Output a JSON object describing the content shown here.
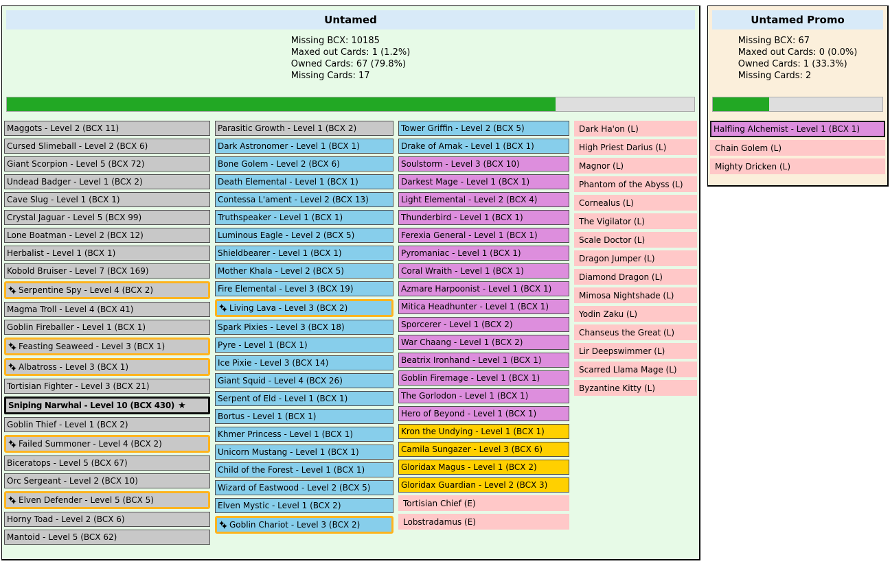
{
  "colors": {
    "panel_untamed_bg": "#E7FAE7",
    "panel_promo_bg": "#FBEFDB",
    "header_bg": "#D8EAF8",
    "progress_fill": "#22A824",
    "common": "#C8C8C8",
    "rare": "#87CEEB",
    "epic": "#DD8EDD",
    "legendary": "#FFD000",
    "missing": "#FFC8C8",
    "foil_border": "#FFB41E"
  },
  "icons": {
    "gold_foil_icon": "sparkles",
    "max_level_icon": "★"
  },
  "panels": [
    {
      "title": "Untamed",
      "stats": [
        "Missing BCX: 10185",
        "Maxed out Cards: 1 (1.2%)",
        "Owned Cards: 67 (79.8%)",
        "Missing Cards: 17"
      ],
      "progress_percent": 79.8,
      "columns": [
        [
          {
            "label": "Maggots - Level 2 (BCX 11)",
            "variant": "common"
          },
          {
            "label": "Cursed Slimeball - Level 2 (BCX 6)",
            "variant": "common"
          },
          {
            "label": "Giant Scorpion - Level 5 (BCX 72)",
            "variant": "common"
          },
          {
            "label": "Undead Badger - Level 1 (BCX 2)",
            "variant": "common"
          },
          {
            "label": "Cave Slug - Level 1 (BCX 1)",
            "variant": "common"
          },
          {
            "label": "Crystal Jaguar - Level 5 (BCX 99)",
            "variant": "common"
          },
          {
            "label": "Lone Boatman - Level 2 (BCX 12)",
            "variant": "common"
          },
          {
            "label": "Herbalist - Level 1 (BCX 1)",
            "variant": "common"
          },
          {
            "label": "Kobold Bruiser - Level 7 (BCX 169)",
            "variant": "common"
          },
          {
            "label": "Serpentine Spy - Level 4 (BCX 2)",
            "variant": "common",
            "foil": true
          },
          {
            "label": "Magma Troll - Level 4 (BCX 41)",
            "variant": "common"
          },
          {
            "label": "Goblin Fireballer - Level 1 (BCX 1)",
            "variant": "common"
          },
          {
            "label": "Feasting Seaweed - Level 3 (BCX 1)",
            "variant": "common",
            "foil": true
          },
          {
            "label": "Albatross - Level 3 (BCX 1)",
            "variant": "common",
            "foil": true
          },
          {
            "label": "Tortisian Fighter - Level 3 (BCX 21)",
            "variant": "common"
          },
          {
            "label": "Sniping Narwhal - Level 10 (BCX 430)",
            "variant": "common",
            "maxed": true
          },
          {
            "label": "Goblin Thief - Level 1 (BCX 2)",
            "variant": "common"
          },
          {
            "label": "Failed Summoner - Level 4 (BCX 2)",
            "variant": "common",
            "foil": true
          },
          {
            "label": "Biceratops - Level 5 (BCX 67)",
            "variant": "common"
          },
          {
            "label": "Orc Sergeant - Level 2 (BCX 10)",
            "variant": "common"
          },
          {
            "label": "Elven Defender - Level 5 (BCX 5)",
            "variant": "common",
            "foil": true
          },
          {
            "label": "Horny Toad - Level 2 (BCX 6)",
            "variant": "common"
          },
          {
            "label": "Mantoid - Level 5 (BCX 62)",
            "variant": "common"
          }
        ],
        [
          {
            "label": "Parasitic Growth - Level 1 (BCX 2)",
            "variant": "common"
          },
          {
            "label": "Dark Astronomer - Level 1 (BCX 1)",
            "variant": "rare"
          },
          {
            "label": "Bone Golem - Level 2 (BCX 6)",
            "variant": "rare"
          },
          {
            "label": "Death Elemental - Level 1 (BCX 1)",
            "variant": "rare"
          },
          {
            "label": "Contessa L'ament - Level 2 (BCX 13)",
            "variant": "rare"
          },
          {
            "label": "Truthspeaker - Level 1 (BCX 1)",
            "variant": "rare"
          },
          {
            "label": "Luminous Eagle - Level 2 (BCX 5)",
            "variant": "rare"
          },
          {
            "label": "Shieldbearer - Level 1 (BCX 1)",
            "variant": "rare"
          },
          {
            "label": "Mother Khala - Level 2 (BCX 5)",
            "variant": "rare"
          },
          {
            "label": "Fire Elemental - Level 3 (BCX 19)",
            "variant": "rare"
          },
          {
            "label": "Living Lava - Level 3 (BCX 2)",
            "variant": "rare",
            "foil": true
          },
          {
            "label": "Spark Pixies - Level 3 (BCX 18)",
            "variant": "rare"
          },
          {
            "label": "Pyre - Level 1 (BCX 1)",
            "variant": "rare"
          },
          {
            "label": "Ice Pixie - Level 3 (BCX 14)",
            "variant": "rare"
          },
          {
            "label": "Giant Squid - Level 4 (BCX 26)",
            "variant": "rare"
          },
          {
            "label": "Serpent of Eld - Level 1 (BCX 1)",
            "variant": "rare"
          },
          {
            "label": "Bortus - Level 1 (BCX 1)",
            "variant": "rare"
          },
          {
            "label": "Khmer Princess - Level 1 (BCX 1)",
            "variant": "rare"
          },
          {
            "label": "Unicorn Mustang - Level 1 (BCX 1)",
            "variant": "rare"
          },
          {
            "label": "Child of the Forest - Level 1 (BCX 1)",
            "variant": "rare"
          },
          {
            "label": "Wizard of Eastwood - Level 2 (BCX 5)",
            "variant": "rare"
          },
          {
            "label": "Elven Mystic - Level 1 (BCX 2)",
            "variant": "rare"
          },
          {
            "label": "Goblin Chariot - Level 3 (BCX 2)",
            "variant": "rare",
            "foil": true
          }
        ],
        [
          {
            "label": "Tower Griffin - Level 2 (BCX 5)",
            "variant": "rare"
          },
          {
            "label": "Drake of Arnak - Level 1 (BCX 1)",
            "variant": "rare"
          },
          {
            "label": "Soulstorm - Level 3 (BCX 10)",
            "variant": "epic"
          },
          {
            "label": "Darkest Mage - Level 1 (BCX 1)",
            "variant": "epic"
          },
          {
            "label": "Light Elemental - Level 2 (BCX 4)",
            "variant": "epic"
          },
          {
            "label": "Thunderbird - Level 1 (BCX 1)",
            "variant": "epic"
          },
          {
            "label": "Ferexia General - Level 1 (BCX 1)",
            "variant": "epic"
          },
          {
            "label": "Pyromaniac - Level 1 (BCX 1)",
            "variant": "epic"
          },
          {
            "label": "Coral Wraith - Level 1 (BCX 1)",
            "variant": "epic"
          },
          {
            "label": "Azmare Harpoonist - Level 1 (BCX 1)",
            "variant": "epic"
          },
          {
            "label": "Mitica Headhunter - Level 1 (BCX 1)",
            "variant": "epic"
          },
          {
            "label": "Sporcerer - Level 1 (BCX 2)",
            "variant": "epic"
          },
          {
            "label": "War Chaang - Level 1 (BCX 2)",
            "variant": "epic"
          },
          {
            "label": "Beatrix Ironhand - Level 1 (BCX 1)",
            "variant": "epic"
          },
          {
            "label": "Goblin Firemage - Level 1 (BCX 1)",
            "variant": "epic"
          },
          {
            "label": "The Gorlodon - Level 1 (BCX 1)",
            "variant": "epic"
          },
          {
            "label": "Hero of Beyond - Level 1 (BCX 1)",
            "variant": "epic"
          },
          {
            "label": "Kron the Undying - Level 1 (BCX 1)",
            "variant": "legendary"
          },
          {
            "label": "Camila Sungazer - Level 3 (BCX 6)",
            "variant": "legendary"
          },
          {
            "label": "Gloridax Magus - Level 1 (BCX 2)",
            "variant": "legendary"
          },
          {
            "label": "Gloridax Guardian - Level 2 (BCX 3)",
            "variant": "legendary"
          },
          {
            "label": "Tortisian Chief (E)",
            "variant": "missing"
          },
          {
            "label": "Lobstradamus (E)",
            "variant": "missing"
          }
        ],
        [
          {
            "label": "Dark Ha'on (L)",
            "variant": "missing"
          },
          {
            "label": "High Priest Darius (L)",
            "variant": "missing"
          },
          {
            "label": "Magnor (L)",
            "variant": "missing"
          },
          {
            "label": "Phantom of the Abyss (L)",
            "variant": "missing"
          },
          {
            "label": "Cornealus (L)",
            "variant": "missing"
          },
          {
            "label": "The Vigilator (L)",
            "variant": "missing"
          },
          {
            "label": "Scale Doctor (L)",
            "variant": "missing"
          },
          {
            "label": "Dragon Jumper (L)",
            "variant": "missing"
          },
          {
            "label": "Diamond Dragon (L)",
            "variant": "missing"
          },
          {
            "label": "Mimosa Nightshade (L)",
            "variant": "missing"
          },
          {
            "label": "Yodin Zaku (L)",
            "variant": "missing"
          },
          {
            "label": "Chanseus the Great (L)",
            "variant": "missing"
          },
          {
            "label": "Lir Deepswimmer (L)",
            "variant": "missing"
          },
          {
            "label": "Scarred Llama Mage (L)",
            "variant": "missing"
          },
          {
            "label": "Byzantine Kitty (L)",
            "variant": "missing"
          }
        ]
      ]
    },
    {
      "title": "Untamed Promo",
      "stats": [
        "Missing BCX: 67",
        "Maxed out Cards: 0 (0.0%)",
        "Owned Cards: 1 (33.3%)",
        "Missing Cards: 2"
      ],
      "progress_percent": 33.3,
      "columns": [
        [
          {
            "label": "Halfling Alchemist - Level 1 (BCX 1)",
            "variant": "epic",
            "framed": true
          },
          {
            "label": "Chain Golem (L)",
            "variant": "missing"
          },
          {
            "label": "Mighty Dricken (L)",
            "variant": "missing"
          }
        ]
      ]
    }
  ]
}
